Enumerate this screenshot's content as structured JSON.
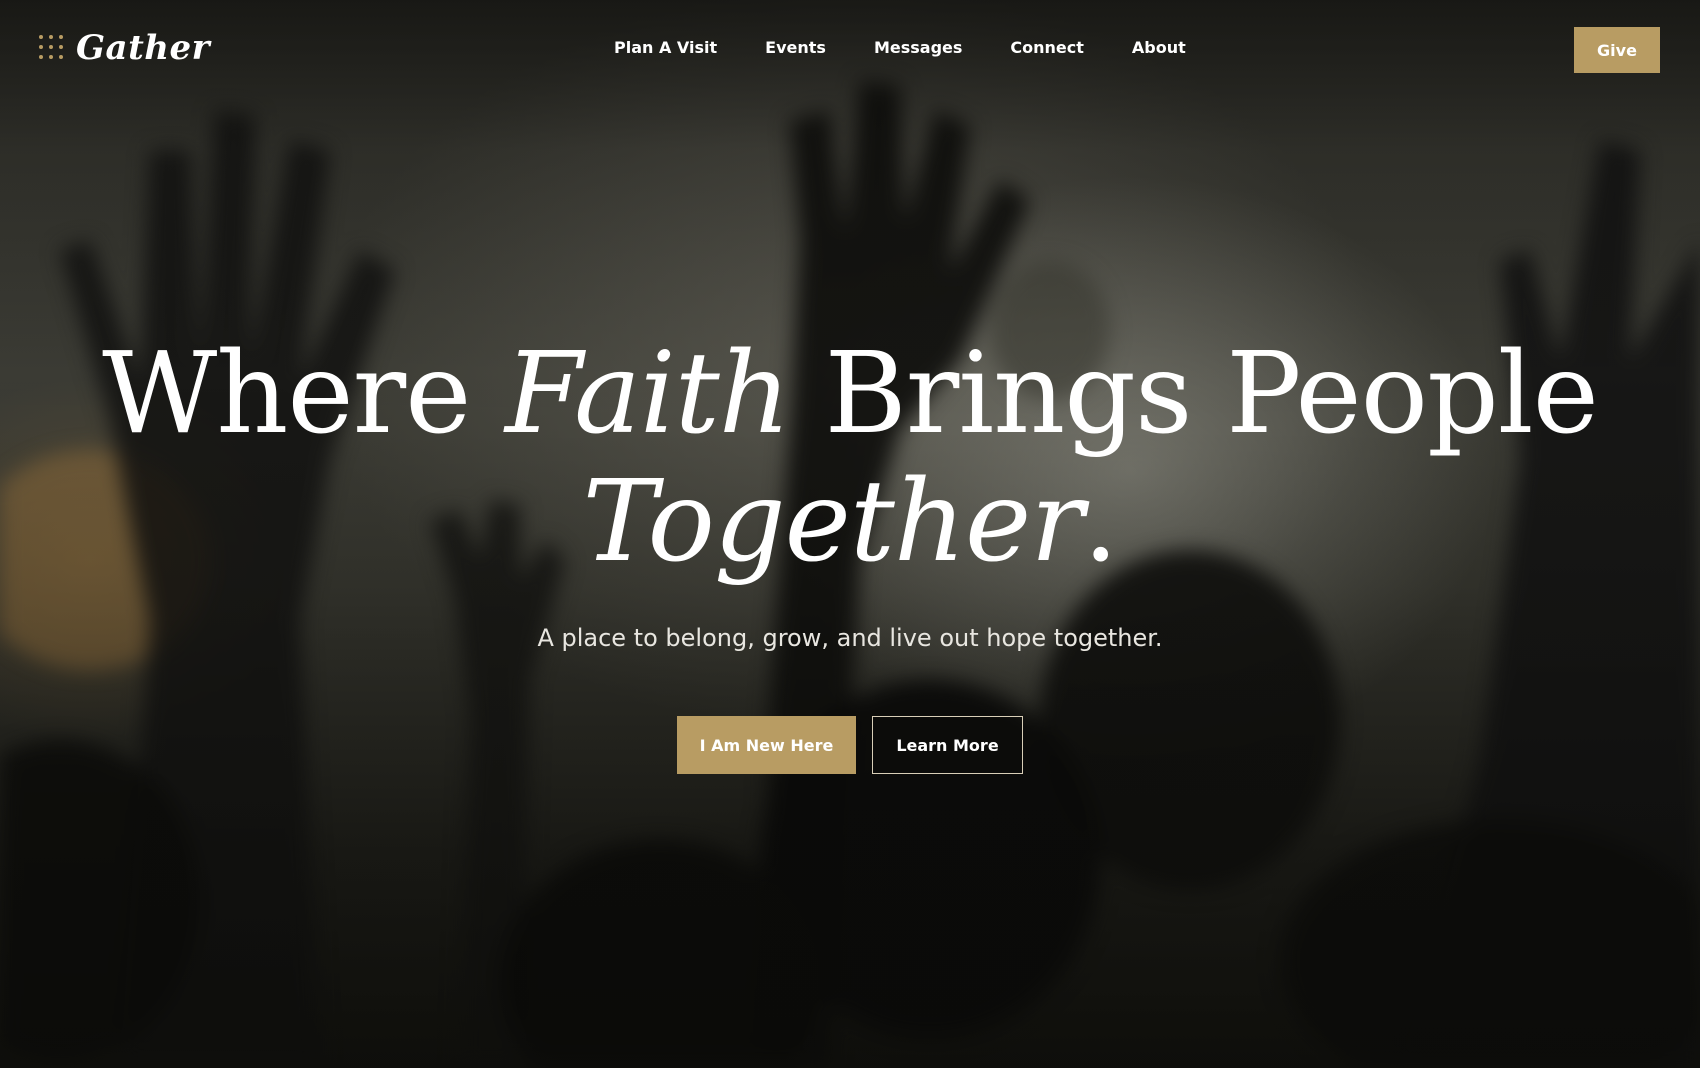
{
  "brand": {
    "name": "Gather",
    "icon": "dot-grid-icon",
    "accent_color": "#b89c63"
  },
  "nav": {
    "items": [
      {
        "label": "Plan A Visit"
      },
      {
        "label": "Events"
      },
      {
        "label": "Messages"
      },
      {
        "label": "Connect"
      },
      {
        "label": "About"
      }
    ],
    "give_label": "Give"
  },
  "hero": {
    "headline_part1": "Where ",
    "headline_italic1": "Faith",
    "headline_part2": " Brings People",
    "headline_italic2": "Together",
    "headline_end": ".",
    "subheading": "A place to belong, grow, and live out hope together.",
    "primary_cta": "I Am New Here",
    "secondary_cta": "Learn More",
    "background": "worship-crowd-raised-hands-photo"
  }
}
